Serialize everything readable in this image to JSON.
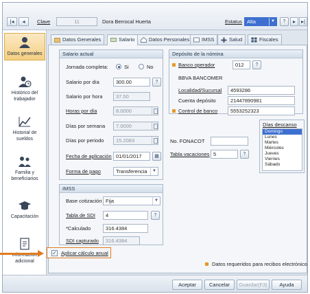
{
  "header": {
    "clave_label": "Clave",
    "clave_value": "11",
    "employee_name": "Dora Berrocal Huerta",
    "estatus_label": "Estatus",
    "estatus_value": "Alta",
    "nav_first": "|◂",
    "nav_prev": "◂",
    "nav_next": "▸",
    "nav_last": "▸|"
  },
  "sidebar": {
    "items": [
      {
        "label": "Datos generales"
      },
      {
        "label": "Histórico del trabajador"
      },
      {
        "label": "Historial de sueldos"
      },
      {
        "label": "Familia y beneficiarios"
      },
      {
        "label": "Capacitación"
      },
      {
        "label": "Información adicional"
      }
    ]
  },
  "tabs": [
    {
      "label": "Datos Generales"
    },
    {
      "label": "Salario"
    },
    {
      "label": "Datos Personales"
    },
    {
      "label": "IMSS"
    },
    {
      "label": "Salud"
    },
    {
      "label": "Fiscales"
    }
  ],
  "salario": {
    "title": "Salario actual",
    "jornada_label": "Jornada completa:",
    "si_label": "Si",
    "no_label": "No",
    "salario_dia_label": "Salario por día",
    "salario_dia_value": "300.00",
    "salario_hora_label": "Salario por hora",
    "salario_hora_value": "37.50",
    "horas_dia_label": "Horas por día",
    "horas_dia_value": "8.0000",
    "dias_semana_label": "Días por semana",
    "dias_semana_value": "7.0000",
    "dias_periodo_label": "Días por periodo",
    "dias_periodo_value": "15.2083",
    "fecha_label": "Fecha de aplicación",
    "fecha_value": "01/01/2017",
    "forma_label": "Forma de pago",
    "forma_value": "Transferencia"
  },
  "imss": {
    "title": "IMSS",
    "base_label": "Base cotización",
    "base_value": "Fija",
    "tabla_label": "Tabla de SDI",
    "tabla_value": "4",
    "calculado_label": "*Calculado",
    "calculado_value": "316.4384",
    "sdi_label": "SDI capturado",
    "sdi_value": "316.4384"
  },
  "aplicar_label": "Aplicar cálculo anual",
  "deposito": {
    "title": "Depósito de la nómina",
    "banco_label": "Banco operador",
    "banco_value": "012",
    "banco_name": "BBVA BANCOMER",
    "localidad_label": "Localidad/Sucursal",
    "localidad_value": "4593286",
    "cuenta_label": "Cuenta depósito",
    "cuenta_value": "21447890981",
    "control_label": "Control de banco",
    "control_value": "5553252323"
  },
  "fonacot_label": "No. FONACOT",
  "fonacot_value": "",
  "vacaciones_label": "Tabla vacaciones",
  "vacaciones_value": "5",
  "dias_descanso": {
    "title": "Días descanso",
    "items": [
      "Domingo",
      "Lunes",
      "Martes",
      "Miércoles",
      "Jueves",
      "Viernes",
      "Sábado"
    ]
  },
  "legend": "Datos requeridos para recibos electrónicos",
  "buttons": {
    "aceptar": "Aceptar",
    "cancelar": "Cancelar",
    "guardar": "Guardar(F3)",
    "ayuda": "Ayuda"
  },
  "colors": {
    "required": "#e59a2c",
    "highlight": "#e07a1f",
    "selected_item": "#3d6fd0"
  }
}
